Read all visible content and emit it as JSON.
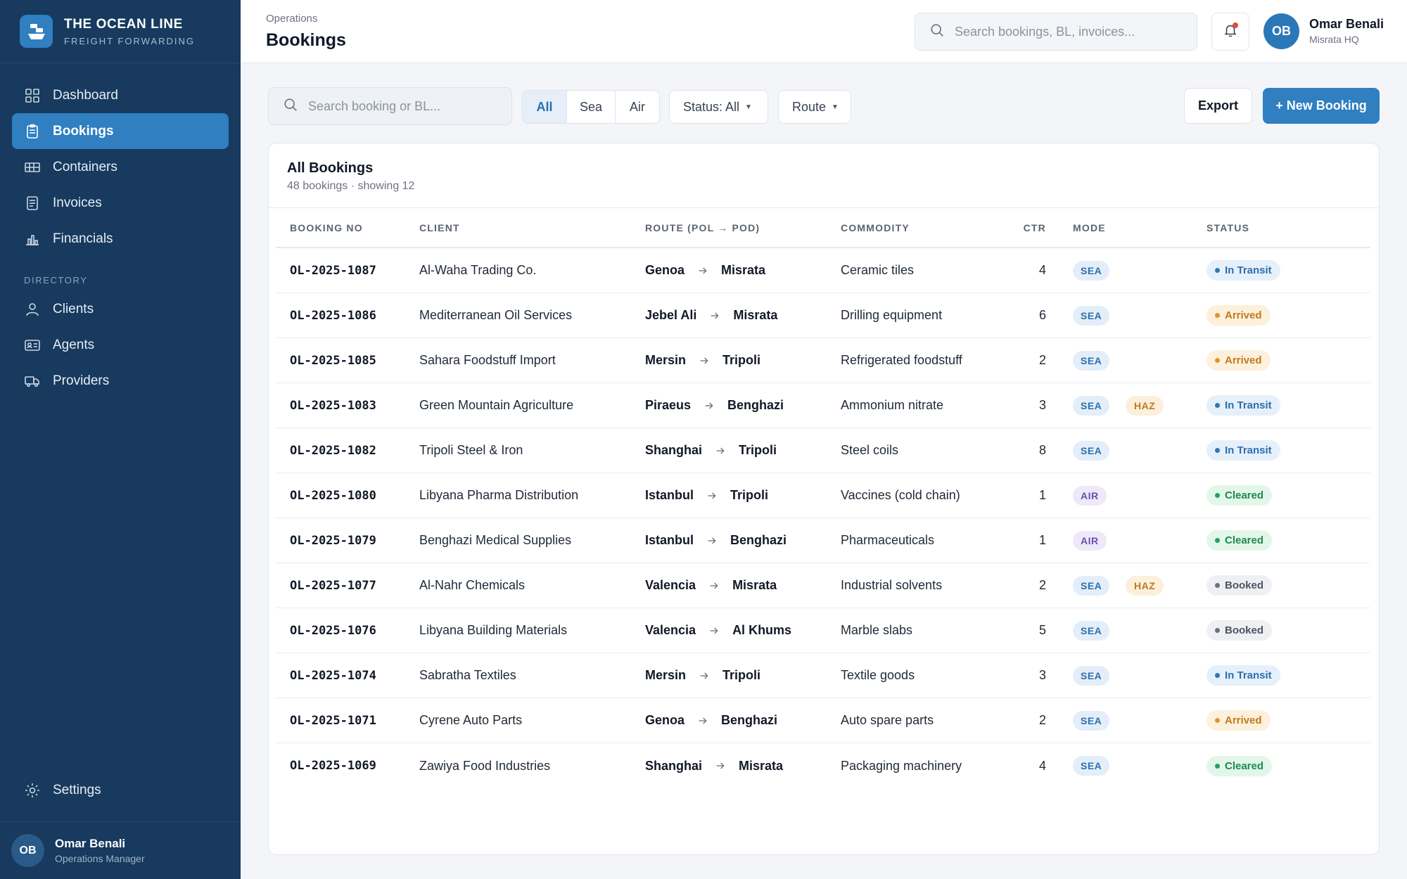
{
  "brand": {
    "name": "THE OCEAN LINE",
    "subtitle": "FREIGHT FORWARDING",
    "logo_icon": "ship-icon"
  },
  "sidebar": {
    "main_items": [
      {
        "label": "Dashboard",
        "icon": "grid-icon",
        "active": false
      },
      {
        "label": "Bookings",
        "icon": "clipboard-icon",
        "active": true
      },
      {
        "label": "Containers",
        "icon": "container-icon",
        "active": false
      },
      {
        "label": "Invoices",
        "icon": "document-icon",
        "active": false
      },
      {
        "label": "Financials",
        "icon": "bar-chart-icon",
        "active": false
      }
    ],
    "section_label": "DIRECTORY",
    "directory_items": [
      {
        "label": "Clients",
        "icon": "person-icon"
      },
      {
        "label": "Agents",
        "icon": "id-card-icon"
      },
      {
        "label": "Providers",
        "icon": "truck-icon"
      }
    ],
    "settings_label": "Settings",
    "user": {
      "initials": "OB",
      "name": "Omar Benali",
      "role": "Operations Manager"
    }
  },
  "header": {
    "breadcrumb": "Operations",
    "title": "Bookings",
    "search_placeholder": "Search bookings, BL, invoices...",
    "user": {
      "initials": "OB",
      "name": "Omar Benali",
      "location": "Misrata HQ"
    }
  },
  "filters": {
    "search_placeholder": "Search booking or BL...",
    "mode_tabs": [
      {
        "label": "All",
        "active": true
      },
      {
        "label": "Sea",
        "active": false
      },
      {
        "label": "Air",
        "active": false
      }
    ],
    "status_label": "Status: All",
    "route_label": "Route",
    "export_label": "Export",
    "new_booking_label": "+ New Booking"
  },
  "table": {
    "title": "All Bookings",
    "subtitle": "48 bookings · showing 12",
    "columns": [
      "BOOKING NO",
      "CLIENT",
      "ROUTE (POL → POD)",
      "COMMODITY",
      "CTR",
      "MODE",
      "STATUS"
    ],
    "rows": [
      {
        "booking": "OL-2025-1087",
        "client": "Al-Waha Trading Co.",
        "pol": "Genoa",
        "pod": "Misrata",
        "commodity": "Ceramic tiles",
        "ctr": "4",
        "mode": "SEA",
        "haz": "",
        "status": "In Transit"
      },
      {
        "booking": "OL-2025-1086",
        "client": "Mediterranean Oil Services",
        "pol": "Jebel Ali",
        "pod": "Misrata",
        "commodity": "Drilling equipment",
        "ctr": "6",
        "mode": "SEA",
        "haz": "",
        "status": "Arrived"
      },
      {
        "booking": "OL-2025-1085",
        "client": "Sahara Foodstuff Import",
        "pol": "Mersin",
        "pod": "Tripoli",
        "commodity": "Refrigerated foodstuff",
        "ctr": "2",
        "mode": "SEA",
        "haz": "",
        "status": "Arrived"
      },
      {
        "booking": "OL-2025-1083",
        "client": "Green Mountain Agriculture",
        "pol": "Piraeus",
        "pod": "Benghazi",
        "commodity": "Ammonium nitrate",
        "ctr": "3",
        "mode": "SEA",
        "haz": "HAZ",
        "status": "In Transit"
      },
      {
        "booking": "OL-2025-1082",
        "client": "Tripoli Steel & Iron",
        "pol": "Shanghai",
        "pod": "Tripoli",
        "commodity": "Steel coils",
        "ctr": "8",
        "mode": "SEA",
        "haz": "",
        "status": "In Transit"
      },
      {
        "booking": "OL-2025-1080",
        "client": "Libyana Pharma Distribution",
        "pol": "Istanbul",
        "pod": "Tripoli",
        "commodity": "Vaccines (cold chain)",
        "ctr": "1",
        "mode": "AIR",
        "haz": "",
        "status": "Cleared"
      },
      {
        "booking": "OL-2025-1079",
        "client": "Benghazi Medical Supplies",
        "pol": "Istanbul",
        "pod": "Benghazi",
        "commodity": "Pharmaceuticals",
        "ctr": "1",
        "mode": "AIR",
        "haz": "",
        "status": "Cleared"
      },
      {
        "booking": "OL-2025-1077",
        "client": "Al-Nahr Chemicals",
        "pol": "Valencia",
        "pod": "Misrata",
        "commodity": "Industrial solvents",
        "ctr": "2",
        "mode": "SEA",
        "haz": "HAZ",
        "status": "Booked"
      },
      {
        "booking": "OL-2025-1076",
        "client": "Libyana Building Materials",
        "pol": "Valencia",
        "pod": "Al Khums",
        "commodity": "Marble slabs",
        "ctr": "5",
        "mode": "SEA",
        "haz": "",
        "status": "Booked"
      },
      {
        "booking": "OL-2025-1074",
        "client": "Sabratha Textiles",
        "pol": "Mersin",
        "pod": "Tripoli",
        "commodity": "Textile goods",
        "ctr": "3",
        "mode": "SEA",
        "haz": "",
        "status": "In Transit"
      },
      {
        "booking": "OL-2025-1071",
        "client": "Cyrene Auto Parts",
        "pol": "Genoa",
        "pod": "Benghazi",
        "commodity": "Auto spare parts",
        "ctr": "2",
        "mode": "SEA",
        "haz": "",
        "status": "Arrived"
      },
      {
        "booking": "OL-2025-1069",
        "client": "Zawiya Food Industries",
        "pol": "Shanghai",
        "pod": "Misrata",
        "commodity": "Packaging machinery",
        "ctr": "4",
        "mode": "SEA",
        "haz": "",
        "status": "Cleared"
      }
    ]
  },
  "colors": {
    "sidebar_bg": "#173a5e",
    "accent": "#2f7fc1",
    "in_transit": "#2b78b8",
    "arrived": "#e69522",
    "cleared": "#22a45a",
    "booked": "#6b7280",
    "haz": "#c07a1c"
  }
}
